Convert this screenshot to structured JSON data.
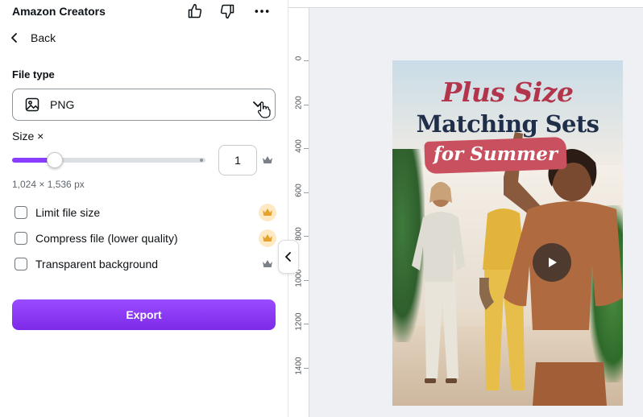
{
  "app": {
    "title": "Amazon Creators"
  },
  "nav": {
    "back_label": "Back"
  },
  "file_type": {
    "label": "File type",
    "selected": "PNG",
    "icon": "image-icon"
  },
  "size": {
    "label": "Size ×",
    "value": "1",
    "slider_fraction": 0.22,
    "dimensions": "1,024 × 1,536 px"
  },
  "options": [
    {
      "label": "Limit file size",
      "checked": false,
      "premium": "crown-badge"
    },
    {
      "label": "Compress file (lower quality)",
      "checked": false,
      "premium": "crown-badge"
    },
    {
      "label": "Transparent background",
      "checked": false,
      "premium": "crown-plain"
    }
  ],
  "export": {
    "label": "Export"
  },
  "ruler": {
    "marks": [
      "0",
      "200",
      "400",
      "600",
      "800",
      "1000",
      "1200",
      "1400"
    ]
  },
  "design": {
    "line1": "Plus Size",
    "line2": "Matching Sets",
    "line3": "for Summer"
  },
  "colors": {
    "accent": "#8b3dff",
    "headline_pink": "#b3354b",
    "headline_navy": "#1f2f4a",
    "banner": "#c9515f"
  }
}
